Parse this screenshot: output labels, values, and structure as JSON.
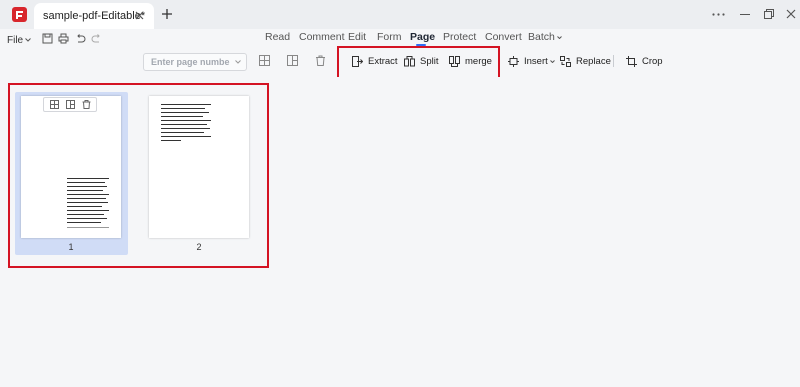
{
  "titlebar": {
    "tab_title": "sample-pdf-Editable*"
  },
  "menubar": {
    "file_label": "File",
    "items": [
      "Read",
      "Comment",
      "Edit",
      "Form",
      "Page",
      "Protect",
      "Convert",
      "Batch"
    ],
    "active_item": "Page"
  },
  "toolbar": {
    "page_input_placeholder": "Enter page number",
    "extract_label": "Extract",
    "split_label": "Split",
    "merge_label": "merge",
    "insert_label": "Insert",
    "replace_label": "Replace",
    "crop_label": "Crop"
  },
  "pages": {
    "items": [
      {
        "number": "1",
        "selected": true
      },
      {
        "number": "2",
        "selected": false
      }
    ]
  },
  "colors": {
    "accent": "#2f6ef5",
    "highlight": "#d41323",
    "selection": "#d0dcf6",
    "brand": "#d8262c"
  }
}
